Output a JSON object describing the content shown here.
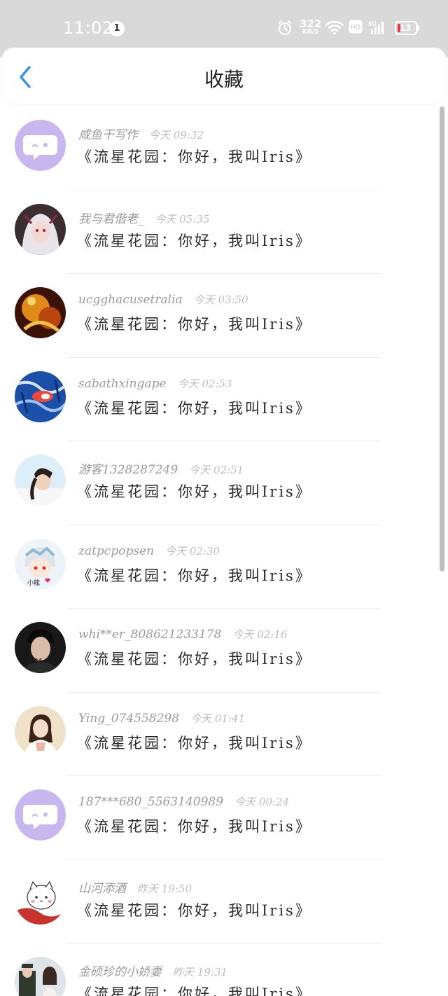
{
  "status_bar": {
    "time": "11:02",
    "notification_count": "1",
    "net_speed_value": "322",
    "net_speed_unit": "KB/S",
    "hd_label": "HD",
    "network_label": "5G",
    "battery_level": "13"
  },
  "header": {
    "title": "收藏",
    "back_icon": "chevron-left-icon",
    "accent_color": "#3a8ee6"
  },
  "list": {
    "items": [
      {
        "username": "咸鱼干写作",
        "time": "今天 09:32",
        "message": "《流星花园：你好，我叫Iris》",
        "avatar": "chat-bubble-default"
      },
      {
        "username": "我与君偕老_",
        "time": "今天 05:35",
        "message": "《流星花园：你好，我叫Iris》",
        "avatar": "white-hair-character"
      },
      {
        "username": "ucgghacusetralia",
        "time": "今天 03:50",
        "message": "《流星花园：你好，我叫Iris》",
        "avatar": "golden-portrait"
      },
      {
        "username": "sabathxingape",
        "time": "今天 02:53",
        "message": "《流星花园：你好，我叫Iris》",
        "avatar": "blue-koi-art"
      },
      {
        "username": "游客1328287249",
        "time": "今天 02:51",
        "message": "《流星花园：你好，我叫Iris》",
        "avatar": "girl-braid-photo"
      },
      {
        "username": "zatpcpopsen",
        "time": "今天 02:30",
        "message": "《流星花园：你好，我叫Iris》",
        "avatar": "anime-chibi"
      },
      {
        "username": "whi**er_808621233178",
        "time": "今天 02:16",
        "message": "《流星花园：你好，我叫Iris》",
        "avatar": "man-portrait"
      },
      {
        "username": "Ying_074558298",
        "time": "今天 01:41",
        "message": "《流星花园：你好，我叫Iris》",
        "avatar": "woman-traditional-dress"
      },
      {
        "username": "187***680_5563140989",
        "time": "今天 00:24",
        "message": "《流星花园：你好，我叫Iris》",
        "avatar": "chat-bubble-default"
      },
      {
        "username": "山河添酒",
        "time": "昨天 19:50",
        "message": "《流星花园：你好，我叫Iris》",
        "avatar": "white-cat-red"
      },
      {
        "username": "金硕珍的小娇妻",
        "time": "昨天 19:31",
        "message": "《流星花园：你好，我叫Iris》",
        "avatar": "couple-photo"
      }
    ]
  }
}
